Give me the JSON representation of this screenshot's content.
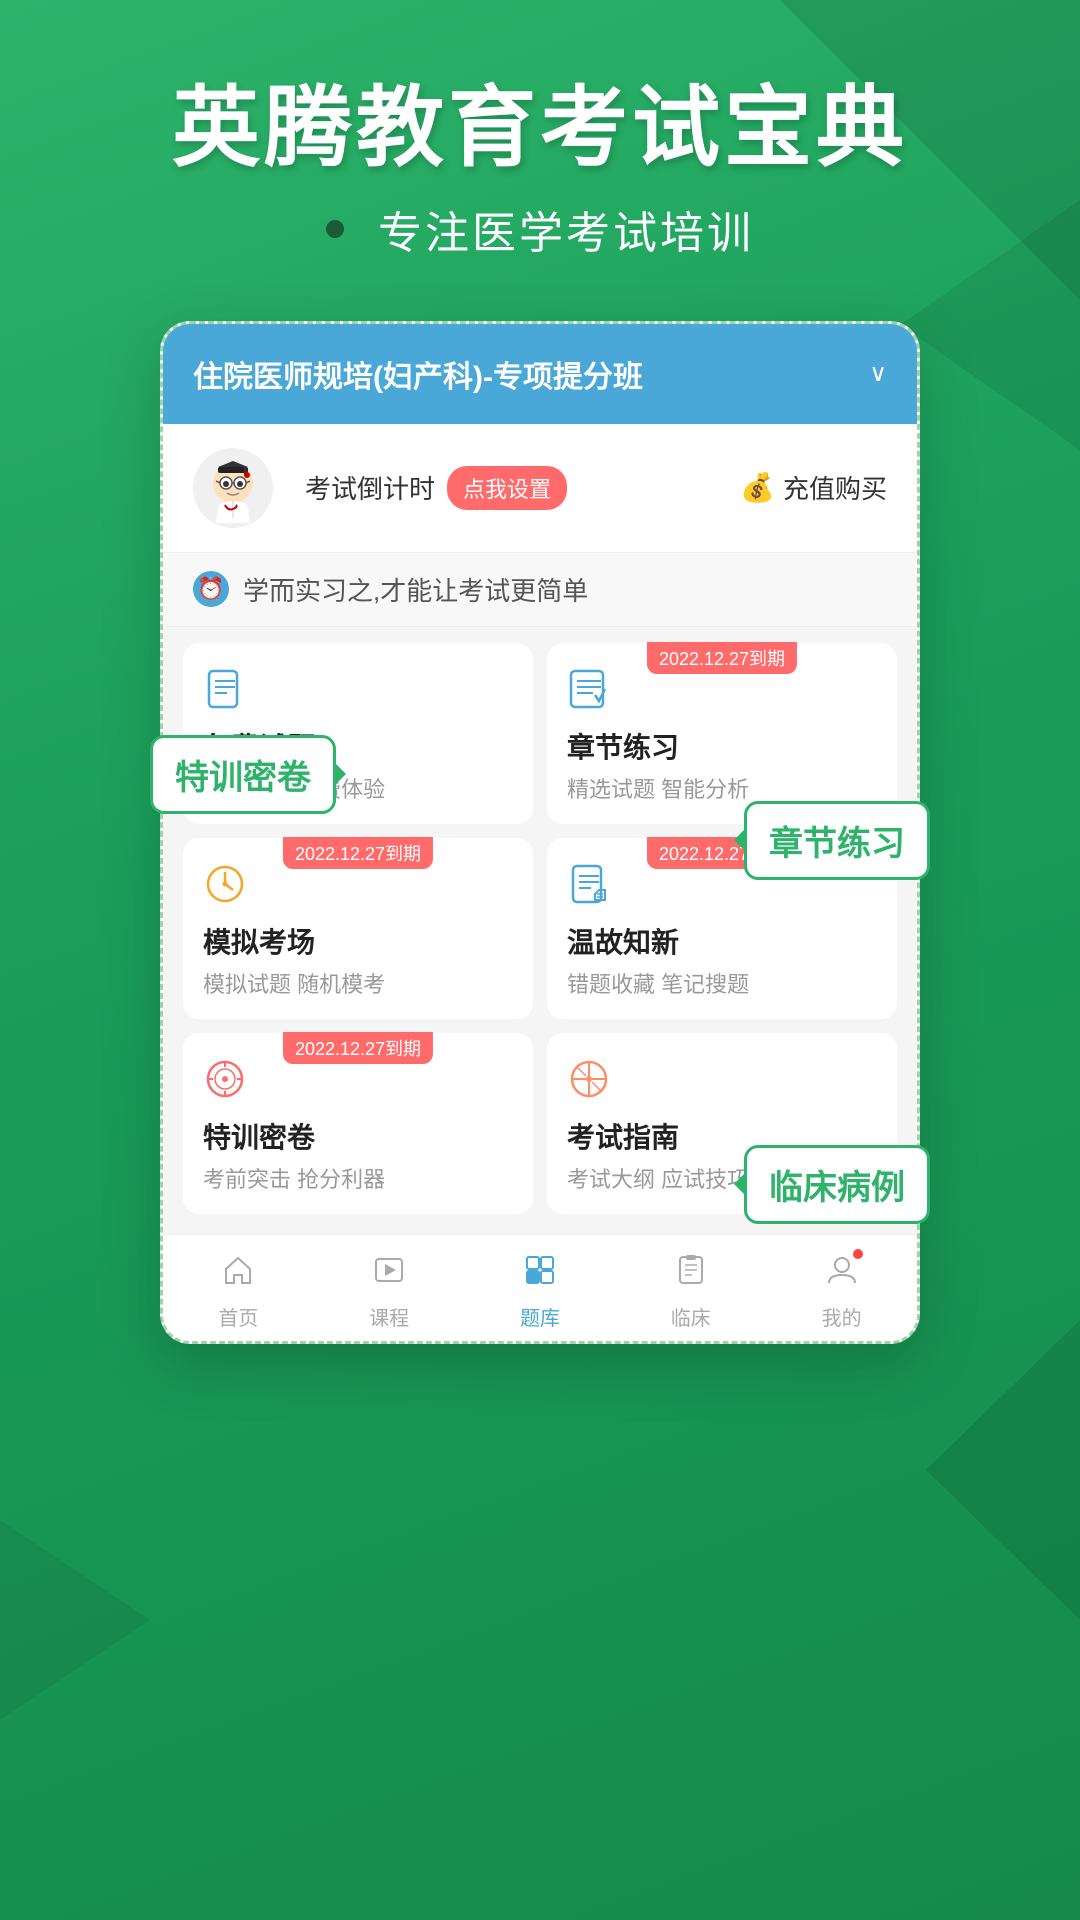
{
  "app": {
    "main_title": "英腾教育考试宝典",
    "subtitle": "专注医学考试培训",
    "course_selector": "住院医师规培(妇产科)-专项提分班",
    "countdown_label": "考试倒计时",
    "countdown_btn": "点我设置",
    "recharge_label": "充值购买",
    "motto": "学而实习之,才能让考试更简单",
    "grid_items": [
      {
        "id": "free",
        "title": "免费试题",
        "subtitle": "精选好题 免费体验",
        "icon": "doc-icon",
        "expire": null,
        "color": "#4aa8d8"
      },
      {
        "id": "chapter",
        "title": "章节练习",
        "subtitle": "精选试题 智能分析",
        "icon": "list-icon",
        "expire": "2022.12.27到期",
        "color": "#4aa8d8"
      },
      {
        "id": "mock",
        "title": "模拟考场",
        "subtitle": "模拟试题 随机模考",
        "icon": "clock-icon",
        "expire": "2022.12.27到期",
        "color": "#f5a623"
      },
      {
        "id": "review",
        "title": "温故知新",
        "subtitle": "错题收藏 笔记搜题",
        "icon": "note-icon",
        "expire": "2022.12.27到期",
        "color": "#4aa8d8"
      },
      {
        "id": "secret",
        "title": "特训密卷",
        "subtitle": "考前突击 抢分利器",
        "icon": "target-icon",
        "expire": "2022.12.27到期",
        "color": "#ff6b6b"
      },
      {
        "id": "guide",
        "title": "考试指南",
        "subtitle": "考试大纲 应试技巧",
        "icon": "compass-icon",
        "expire": null,
        "color": "#ff8c69"
      }
    ],
    "nav_items": [
      {
        "id": "home",
        "label": "首页",
        "icon": "home",
        "active": false
      },
      {
        "id": "course",
        "label": "课程",
        "icon": "video",
        "active": false
      },
      {
        "id": "tiku",
        "label": "题库",
        "icon": "grid",
        "active": true
      },
      {
        "id": "clinical",
        "label": "临床",
        "icon": "clipboard",
        "active": false
      },
      {
        "id": "mine",
        "label": "我的",
        "icon": "user",
        "active": false
      }
    ],
    "callouts": {
      "chapter": "章节练习",
      "secret": "特训密卷",
      "clinical": "临床病例"
    }
  }
}
